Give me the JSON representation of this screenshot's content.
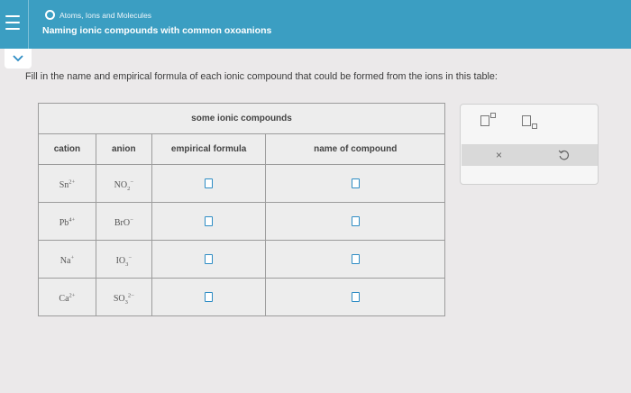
{
  "header": {
    "topic": "Atoms, Ions and Molecules",
    "title": "Naming ionic compounds with common oxoanions"
  },
  "instructions": "Fill in the name and empirical formula of each ionic compound that could be formed from the ions in this table:",
  "table": {
    "caption": "some ionic compounds",
    "columns": [
      "cation",
      "anion",
      "empirical formula",
      "name of compound"
    ],
    "rows": [
      {
        "cation": {
          "symbol": "Sn",
          "charge": "2+"
        },
        "anion": {
          "base": "NO",
          "sub": "2",
          "charge": "−"
        }
      },
      {
        "cation": {
          "symbol": "Pb",
          "charge": "4+"
        },
        "anion": {
          "base": "BrO",
          "sub": "",
          "charge": "−"
        }
      },
      {
        "cation": {
          "symbol": "Na",
          "charge": "+"
        },
        "anion": {
          "base": "IO",
          "sub": "3",
          "charge": "−"
        }
      },
      {
        "cation": {
          "symbol": "Ca",
          "charge": "2+"
        },
        "anion": {
          "base": "SO",
          "sub": "3",
          "charge": "2−"
        }
      }
    ]
  },
  "toolbar": {
    "tools": [
      "superscript-tool",
      "subscript-tool"
    ],
    "clear_label": "×",
    "undo_label": "undo"
  },
  "colors": {
    "header": "#3b9ec2",
    "input_border": "#2d8cc4",
    "background": "#ebe9ea"
  }
}
